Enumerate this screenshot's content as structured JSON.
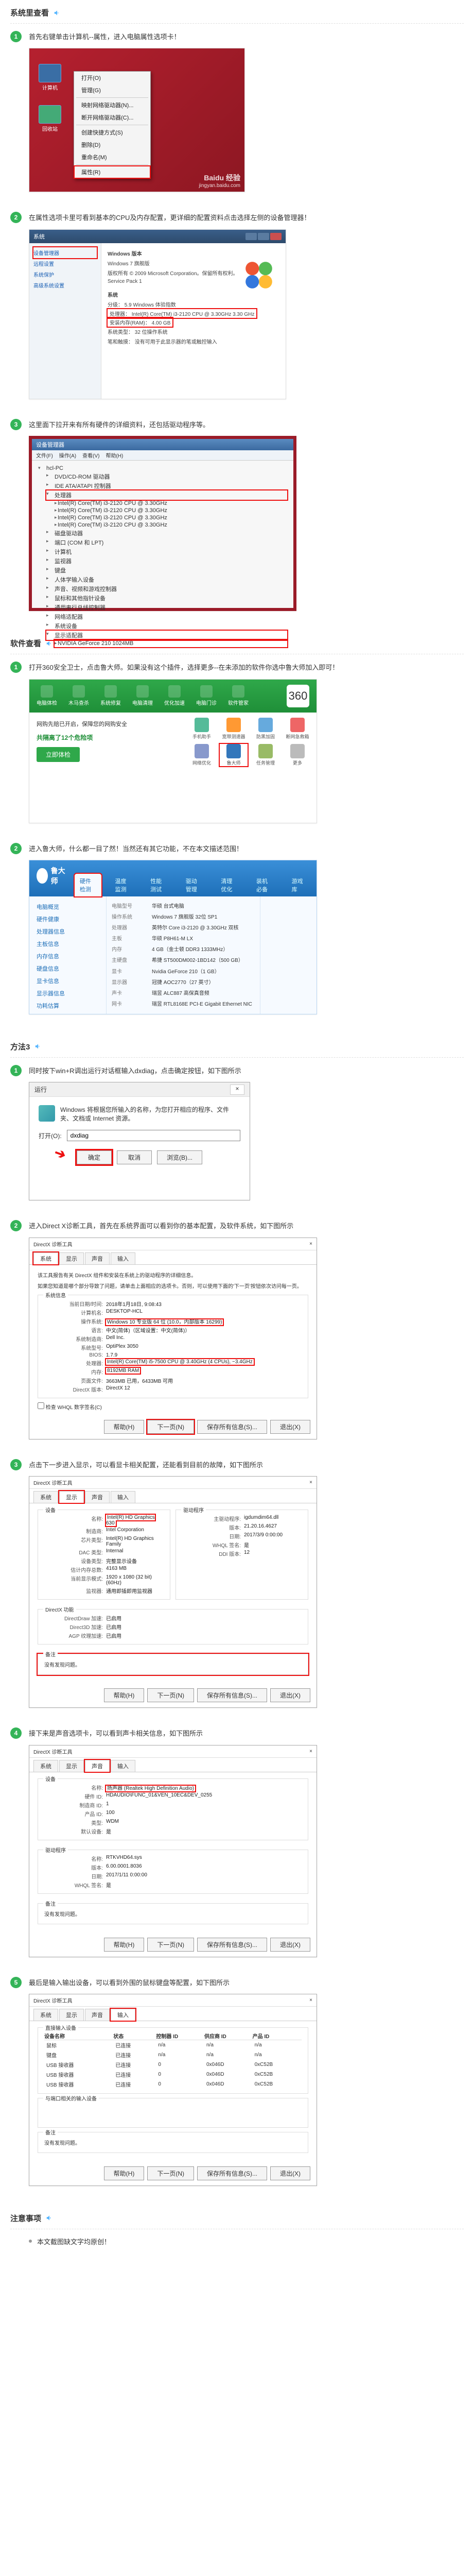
{
  "sections": {
    "sys": {
      "title": "系统里查看"
    },
    "soft": {
      "title": "软件查看"
    },
    "m3": {
      "title": "方法3"
    },
    "notes": {
      "title": "注意事项"
    }
  },
  "sys_steps": {
    "s1": "首先右键单击计算机--属性，进入电脑属性选项卡！",
    "s2": "在属性选项卡里可看到基本的CPU及内存配置，更详细的配置资料点击选择左侧的设备管理器！",
    "s3": "这里面下拉开来有所有硬件的详细资料，还包括驱动程序等。"
  },
  "soft_steps": {
    "s1": "打开360安全卫士，点击鲁大师。如果没有这个插件，选择更多--在未添加的软件你选中鲁大师加入即可！",
    "s2": "进入鲁大师，什么都一目了然！当然还有其它功能，不在本文描述范围！"
  },
  "m3_steps": {
    "s1": "同时按下win+R调出运行对话框输入dxdiag，点击确定按钮，如下图所示",
    "s2": "进入Direct X诊断工具，首先在系统界面可以看到你的基本配置，及软件系统，如下图所示",
    "s3": "点击下一步进入显示，可以看显卡相关配置，还能看到目前的故障，如下图所示",
    "s4": "接下来是声音选项卡，可以看到声卡相关信息，如下图所示",
    "s5": "最后是输入输出设备，可以看到外围的鼠标键盘等配置，如下图所示"
  },
  "notes": {
    "n1": "本文截图缺文字均原创！"
  },
  "ss_desktop": {
    "icons": {
      "computer": "计算机",
      "recycle": "回收站"
    },
    "menu": {
      "open": "打开(O)",
      "manage": "管理(G)",
      "mapdrive": "映射网络驱动器(N)...",
      "disconnect": "断开网络驱动器(C)...",
      "shortcut": "创建快捷方式(S)",
      "delete": "删除(D)",
      "rename": "重命名(M)",
      "properties": "属性(R)"
    },
    "wm": {
      "brand": "Baidu 经验",
      "url": "jingyan.baidu.com"
    }
  },
  "ss_sys": {
    "title": "系统",
    "left": {
      "devmgr": "设备管理器",
      "remote": "远程设置",
      "protect": "系统保护",
      "advanced": "高级系统设置"
    },
    "right": {
      "edition_h": "Windows 版本",
      "edition": "Windows 7 旗舰版",
      "copyright": "版权所有 © 2009 Microsoft Corporation。保留所有权利。",
      "sp": "Service Pack 1",
      "sys_h": "系统",
      "rating_l": "分级：",
      "rating_v": "5.9 Windows 体验指数",
      "cpu_l": "处理器：",
      "cpu_v": "Intel(R) Core(TM) i3-2120 CPU @ 3.30GHz  3.30 GHz",
      "ram_l": "安装内存(RAM)：",
      "ram_v": "4.00 GB",
      "type_l": "系统类型：",
      "type_v": "32 位操作系统",
      "pen_l": "笔和触摸：",
      "pen_v": "没有可用于此显示器的笔或触控输入"
    }
  },
  "ss_dev": {
    "title": "设备管理器",
    "menu": {
      "file": "文件(F)",
      "action": "操作(A)",
      "view": "查看(V)",
      "help": "帮助(H)"
    },
    "nodes": {
      "root": "hcl-PC",
      "dvd": "DVD/CD-ROM 驱动器",
      "ide": "IDE ATA/ATAPI 控制器",
      "cpu": "处理器",
      "cpu1": "Intel(R) Core(TM) i3-2120 CPU @ 3.30GHz",
      "cpu2": "Intel(R) Core(TM) i3-2120 CPU @ 3.30GHz",
      "cpu3": "Intel(R) Core(TM) i3-2120 CPU @ 3.30GHz",
      "cpu4": "Intel(R) Core(TM) i3-2120 CPU @ 3.30GHz",
      "disk": "磁盘驱动器",
      "port": "端口 (COM 和 LPT)",
      "pc": "计算机",
      "mon": "监视器",
      "kbd": "键盘",
      "hid": "人体学输入设备",
      "snd": "声音、视频和游戏控制器",
      "mouse": "鼠标和其他指针设备",
      "usb": "通用串行总线控制器",
      "net": "网络适配器",
      "sysdev": "系统设备",
      "gfx": "显示适配器",
      "gfx1": "NVIDIA GeForce 210   1024MB"
    }
  },
  "ss_360": {
    "tabs": {
      "t1": "电脑体检",
      "t2": "木马查杀",
      "t3": "系统修复",
      "t4": "电脑清理",
      "t5": "优化加速",
      "t6": "电脑门诊",
      "t7": "软件管家"
    },
    "avatar": "360",
    "msg": "网购先赔已开启，保障您的网购安全",
    "count": "共隔离了12个危险项",
    "btn": "立即体检",
    "tools": {
      "a": "手机助手",
      "b": "宽带测速器",
      "c": "防黑加固",
      "d": "断网急救箱",
      "e": "网络优化",
      "f": "鲁大师",
      "g": "任务管理",
      "h": "更多"
    }
  },
  "ss_lds": {
    "brand": "鲁大师",
    "tabs": {
      "t1": "硬件检测",
      "t2": "温度监测",
      "t3": "性能测试",
      "t4": "驱动管理",
      "t5": "清理优化",
      "t6": "装机必备",
      "t7": "游戏库"
    },
    "cats": {
      "c1": "电脑概览",
      "c2": "硬件健康",
      "c3": "处理器信息",
      "c4": "主板信息",
      "c5": "内存信息",
      "c6": "硬盘信息",
      "c7": "显卡信息",
      "c8": "显示器信息",
      "c9": "功耗估算"
    },
    "fields": {
      "model_l": "电脑型号",
      "model_v": "华硕 台式电脑",
      "os_l": "操作系统",
      "os_v": "Windows 7 旗舰版 32位 SP1",
      "cpu_l": "处理器",
      "cpu_v": "英特尔 Core i3-2120 @ 3.30GHz 双核",
      "mb_l": "主板",
      "mb_v": "华硕 P8H61-M LX",
      "ram_l": "内存",
      "ram_v": "4 GB（金士顿 DDR3 1333MHz）",
      "hd_l": "主硬盘",
      "hd_v": "希捷 ST500DM002-1BD142（500 GB）",
      "gfx_l": "显卡",
      "gfx_v": "Nvidia GeForce 210（1 GB）",
      "mon_l": "显示器",
      "mon_v": "冠捷 AOC2770（27 英寸）",
      "snd_l": "声卡",
      "snd_v": "瑞昱 ALC887 高保真音频",
      "net_l": "网卡",
      "net_v": "瑞昱 RTL8168E PCI-E Gigabit Ethernet NIC"
    }
  },
  "ss_run": {
    "title": "运行",
    "desc": "Windows 将根据您所输入的名称，为您打开相应的程序、文件夹、文档或 Internet 资源。",
    "open_l": "打开(O):",
    "value": "dxdiag",
    "ok": "确定",
    "cancel": "取消",
    "browse": "浏览(B)..."
  },
  "dx": {
    "title": "DirectX 诊断工具",
    "tabs": {
      "sys": "系统",
      "disp": "显示",
      "snd": "声音",
      "inp": "输入"
    },
    "btns": {
      "next": "下一页(N)",
      "save": "保存所有信息(S)...",
      "exit": "退出(X)",
      "help": "帮助(H)"
    },
    "sys": {
      "intro": "该工具报告有关 DirectX 组件和安装在系统上的驱动程序的详细信息。",
      "help": "如果您知道是哪个部分导致了问题，请单击上面相应的选项卡。否则，可以使用下面的'下一页'按钮依次访问每一页。",
      "group": "系统信息",
      "date_l": "当前日期/时间:",
      "date_v": "2018年1月18日, 9:08:43",
      "name_l": "计算机名:",
      "name_v": "DESKTOP-HCL",
      "os_l": "操作系统:",
      "os_v": "Windows 10 专业版 64 位 (10.0，内部版本 16299)",
      "lang_l": "语言:",
      "lang_v": "中文(简体)（区域设置：中文(简体)）",
      "mfr_l": "系统制造商:",
      "mfr_v": "Dell Inc.",
      "model_l": "系统型号:",
      "model_v": "OptiPlex 3050",
      "bios_l": "BIOS:",
      "bios_v": "1.7.9",
      "cpu_l": "处理器:",
      "cpu_v": "Intel(R) Core(TM) i5-7500 CPU @ 3.40GHz (4 CPUs), ~3.4GHz",
      "mem_l": "内存:",
      "mem_v": "8192MB RAM",
      "page_l": "页面文件:",
      "page_v": "3663MB 已用，6433MB 可用",
      "dxv_l": "DirectX 版本:",
      "dxv_v": "DirectX 12",
      "whql": "检查 WHQL 数字签名(C)"
    },
    "disp": {
      "dev_h": "设备",
      "drv_h": "驱动程序",
      "name_l": "名称:",
      "name_v": "Intel(R) HD Graphics 630",
      "mfr_l": "制造商:",
      "mfr_v": "Intel Corporation",
      "chip_l": "芯片类型:",
      "chip_v": "Intel(R) HD Graphics Family",
      "dac_l": "DAC 类型:",
      "dac_v": "Internal",
      "devtype_l": "设备类型:",
      "devtype_v": "完整显示设备",
      "total_l": "估计内存总数:",
      "total_v": "4163 MB",
      "mode_l": "当前显示模式:",
      "mode_v": "1920 x 1080 (32 bit) (60Hz)",
      "mon_l": "监视器:",
      "mon_v": "通用即插即用监视器",
      "drv_l": "主驱动程序:",
      "drv_v": "igdumdim64.dll",
      "ver_l": "版本:",
      "ver_v": "21.20.16.4627",
      "ddate_l": "日期:",
      "ddate_v": "2017/3/9 0:00:00",
      "whql_l": "WHQL 签名:",
      "whql_v": "是",
      "ddi_l": "DDI 版本:",
      "ddi_v": "12",
      "feat_h": "DirectX 功能",
      "dd_l": "DirectDraw 加速:",
      "dd_v": "已启用",
      "d3d_l": "Direct3D 加速:",
      "d3d_v": "已启用",
      "agp_l": "AGP 纹理加速:",
      "agp_v": "已启用",
      "notes_h": "备注",
      "notes_v": "没有发现问题。"
    },
    "snd": {
      "dev_h": "设备",
      "drv_h": "驱动程序",
      "name_l": "名称:",
      "name_v": "扬声器 (Realtek High Definition Audio)",
      "hwid_l": "硬件 ID:",
      "hwid_v": "HDAUDIO\\FUNC_01&VEN_10EC&DEV_0255",
      "mfr_l": "制造商 ID:",
      "mfr_v": "1",
      "prod_l": "产品 ID:",
      "prod_v": "100",
      "type_l": "类型:",
      "type_v": "WDM",
      "def_l": "默认设备:",
      "def_v": "是",
      "drvname_l": "名称:",
      "drvname_v": "RTKVHD64.sys",
      "ver_l": "版本:",
      "ver_v": "6.00.0001.8036",
      "date_l": "日期:",
      "date_v": "2017/1/11 0:00:00",
      "whql_l": "WHQL 签名:",
      "whql_v": "是",
      "notes_h": "备注",
      "notes_v": "没有发现问题。"
    },
    "inp": {
      "group1": "直接输入设备",
      "cols": {
        "c1": "设备名称",
        "c2": "状态",
        "c3": "控制器 ID",
        "c4": "供应商 ID",
        "c5": "产品 ID"
      },
      "rows": [
        {
          "c1": "鼠标",
          "c2": "已连接",
          "c3": "n/a",
          "c4": "n/a",
          "c5": "n/a"
        },
        {
          "c1": "键盘",
          "c2": "已连接",
          "c3": "n/a",
          "c4": "n/a",
          "c5": "n/a"
        },
        {
          "c1": "USB 接收器",
          "c2": "已连接",
          "c3": "0",
          "c4": "0x046D",
          "c5": "0xC52B"
        },
        {
          "c1": "USB 接收器",
          "c2": "已连接",
          "c3": "0",
          "c4": "0x046D",
          "c5": "0xC52B"
        },
        {
          "c1": "USB 接收器",
          "c2": "已连接",
          "c3": "0",
          "c4": "0x046D",
          "c5": "0xC52B"
        }
      ],
      "group2": "与端口相关的输入设备",
      "notes_h": "备注",
      "notes_v": "没有发现问题。"
    }
  }
}
